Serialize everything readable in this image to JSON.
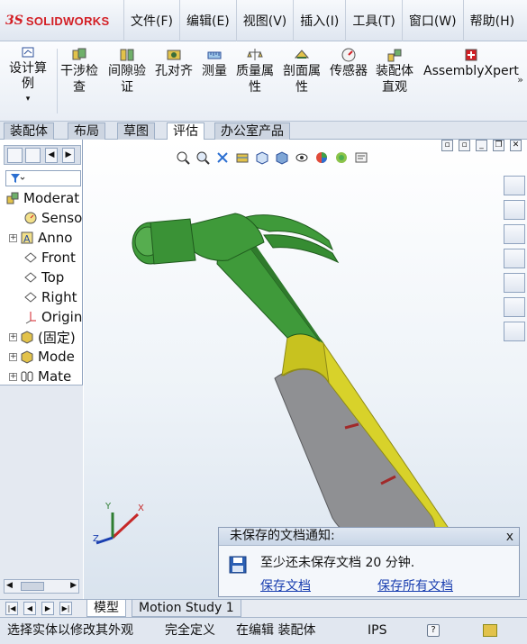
{
  "app": {
    "logo_text": "SOLIDWORKS",
    "logo_mark": "3S"
  },
  "menu": [
    "文件(F)",
    "编辑(E)",
    "视图(V)",
    "插入(I)",
    "工具(T)",
    "窗口(W)",
    "帮助(H)"
  ],
  "toolbar": {
    "first": {
      "line1": "设计算",
      "line2": "例",
      "icon": "design-study-icon"
    },
    "commands": [
      {
        "line1": "干涉检",
        "line2": "查",
        "icon": "interference-icon"
      },
      {
        "line1": "间隙验",
        "line2": "证",
        "icon": "clearance-icon"
      },
      {
        "line1": "孔对齐",
        "line2": "",
        "icon": "hole-alignment-icon"
      },
      {
        "line1": "测量",
        "line2": "",
        "icon": "measure-icon"
      },
      {
        "line1": "质量属",
        "line2": "性",
        "icon": "mass-properties-icon"
      },
      {
        "line1": "剖面属",
        "line2": "性",
        "icon": "section-properties-icon"
      },
      {
        "line1": "传感器",
        "line2": "",
        "icon": "sensor-icon"
      },
      {
        "line1": "装配体",
        "line2": "直观",
        "icon": "assembly-visualization-icon"
      },
      {
        "line1": "AssemblyXpert",
        "line2": "",
        "icon": "assemblyxpert-icon"
      }
    ]
  },
  "tabs": [
    "装配体",
    "布局",
    "草图",
    "评估",
    "办公室产品"
  ],
  "active_tab": "评估",
  "tree": [
    {
      "label": "Moderat",
      "icon": "assembly-icon",
      "expander": false
    },
    {
      "label": "Senso",
      "icon": "sensor-icon",
      "expander": false
    },
    {
      "label": "Anno",
      "icon": "annotations-icon",
      "expander": true
    },
    {
      "label": "Front",
      "icon": "plane-icon",
      "expander": false
    },
    {
      "label": "Top",
      "icon": "plane-icon",
      "expander": false
    },
    {
      "label": "Right",
      "icon": "plane-icon",
      "expander": false
    },
    {
      "label": "Origin",
      "icon": "origin-icon",
      "expander": false
    },
    {
      "label": "(固定)",
      "icon": "part-icon",
      "expander": true
    },
    {
      "label": "Mode",
      "icon": "part-icon",
      "expander": true
    },
    {
      "label": "Mate",
      "icon": "mates-icon",
      "expander": true
    }
  ],
  "notification": {
    "title": "未保存的文档通知:",
    "message": "至少还未保存文档 20 分钟.",
    "link_save": "保存文档",
    "link_save_all": "保存所有文档",
    "close": "x"
  },
  "model_tabs": [
    "模型",
    "Motion Study 1"
  ],
  "status": {
    "hint": "选择实体以修改其外观",
    "state": "完全定义",
    "editing": "在编辑 装配体",
    "units": "IPS",
    "help": "?"
  },
  "axes": {
    "x": "X",
    "y": "Y",
    "z": "Z"
  },
  "colors": {
    "hammer_head": "#3f9a3a",
    "handle_yellow": "#d8d22a",
    "grip_gray": "#8f9093",
    "accent_red": "#d31e24",
    "link_blue": "#1a3fb0"
  }
}
